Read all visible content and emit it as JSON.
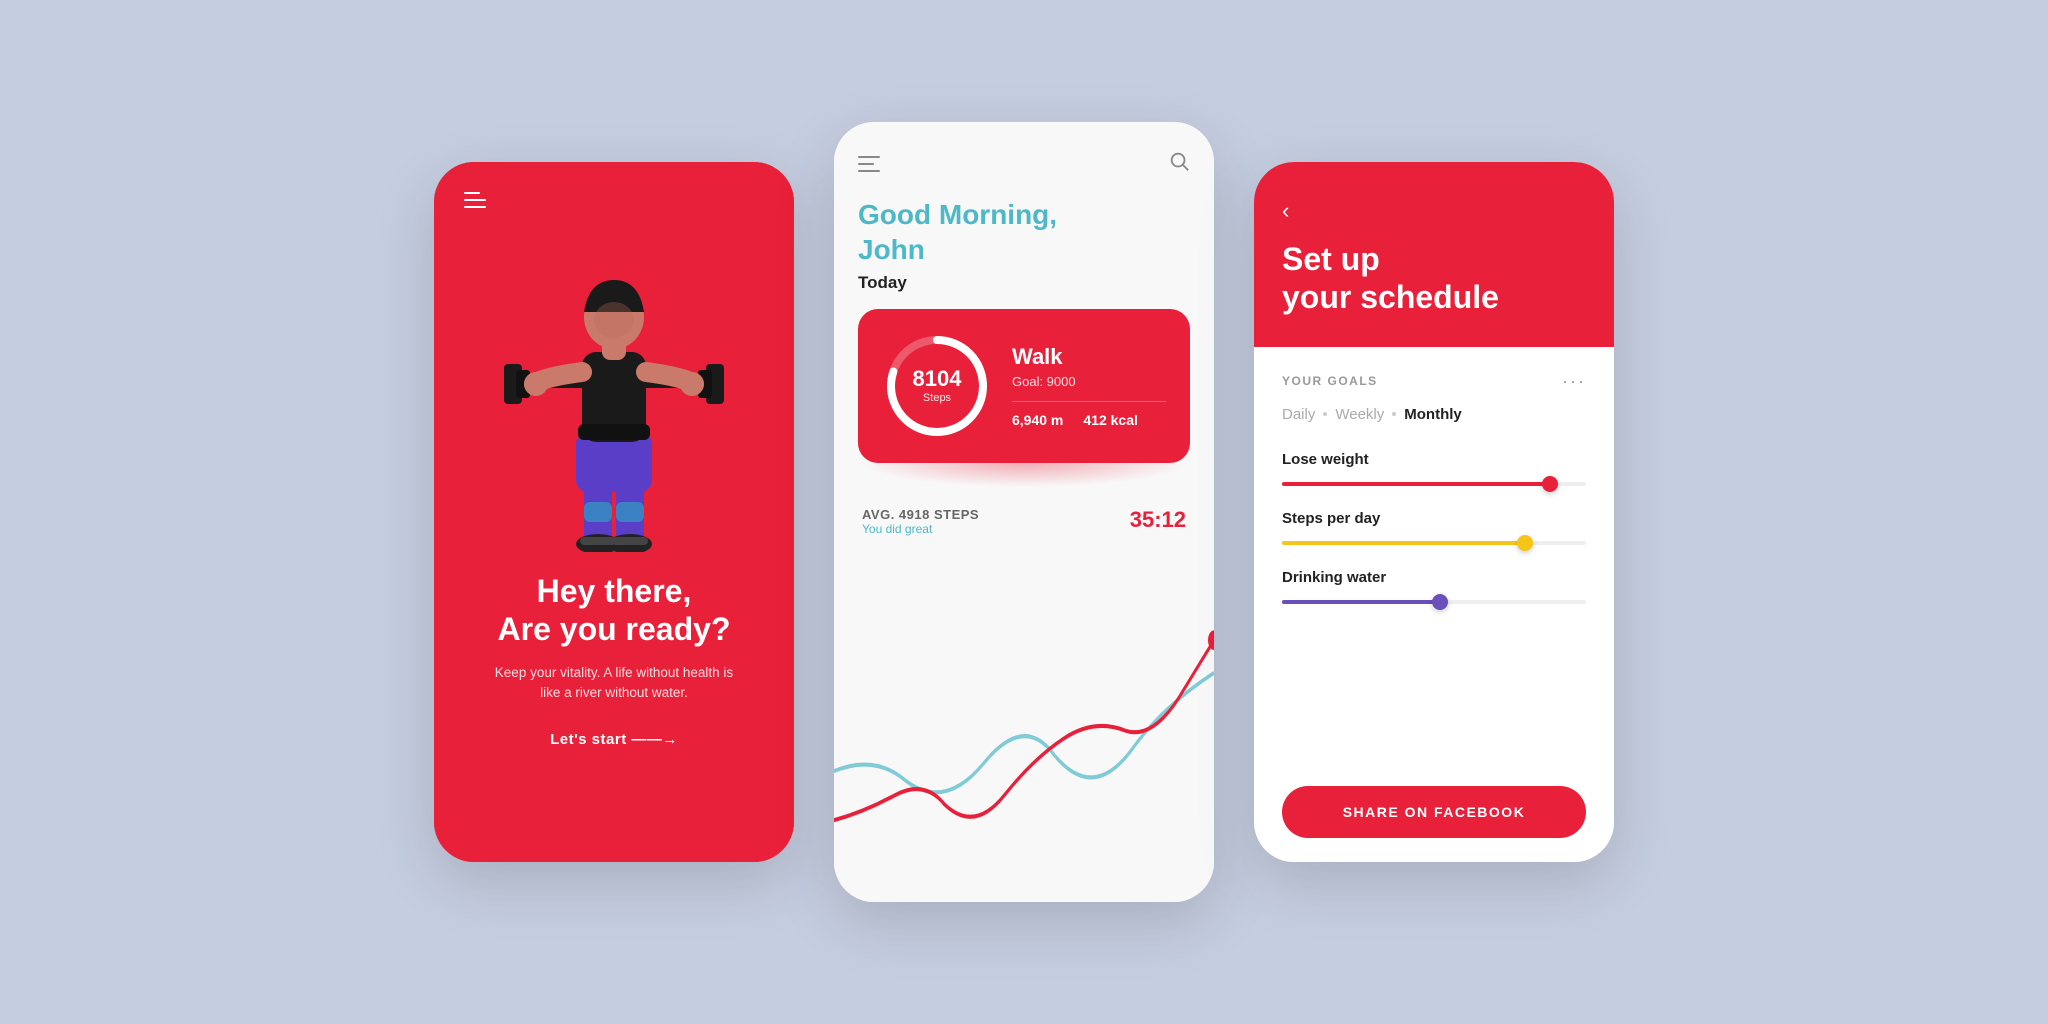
{
  "background": "#c5cde0",
  "phone1": {
    "headline": "Hey there,\nAre you ready?",
    "subtext": "Keep your vitality. A life without health is like a river without water.",
    "cta": "Let's start  ——→"
  },
  "phone2": {
    "greeting": "Good Morning,\nJohn",
    "today": "Today",
    "steps_count": "8104",
    "steps_label": "Steps",
    "walk_title": "Walk",
    "walk_goal": "Goal: 9000",
    "walk_distance": "6,940 m",
    "walk_kcal": "412 kcal",
    "avg_label": "AVG. 4918 STEPS",
    "avg_sublabel": "You did great",
    "avg_time": "35:12"
  },
  "phone3": {
    "title": "Set up\nyour schedule",
    "section_label": "YOUR GOALS",
    "tabs": [
      {
        "label": "Daily",
        "active": false
      },
      {
        "label": "Weekly",
        "active": false
      },
      {
        "label": "Monthly",
        "active": true
      }
    ],
    "sliders": [
      {
        "label": "Lose weight",
        "fill_pct": 88,
        "color": "#E8203A"
      },
      {
        "label": "Steps per day",
        "fill_pct": 80,
        "color": "#F5C518"
      },
      {
        "label": "Drinking water",
        "fill_pct": 52,
        "color": "#6B4FBB"
      }
    ],
    "facebook_btn": "SHARE ON FACEBOOK"
  }
}
